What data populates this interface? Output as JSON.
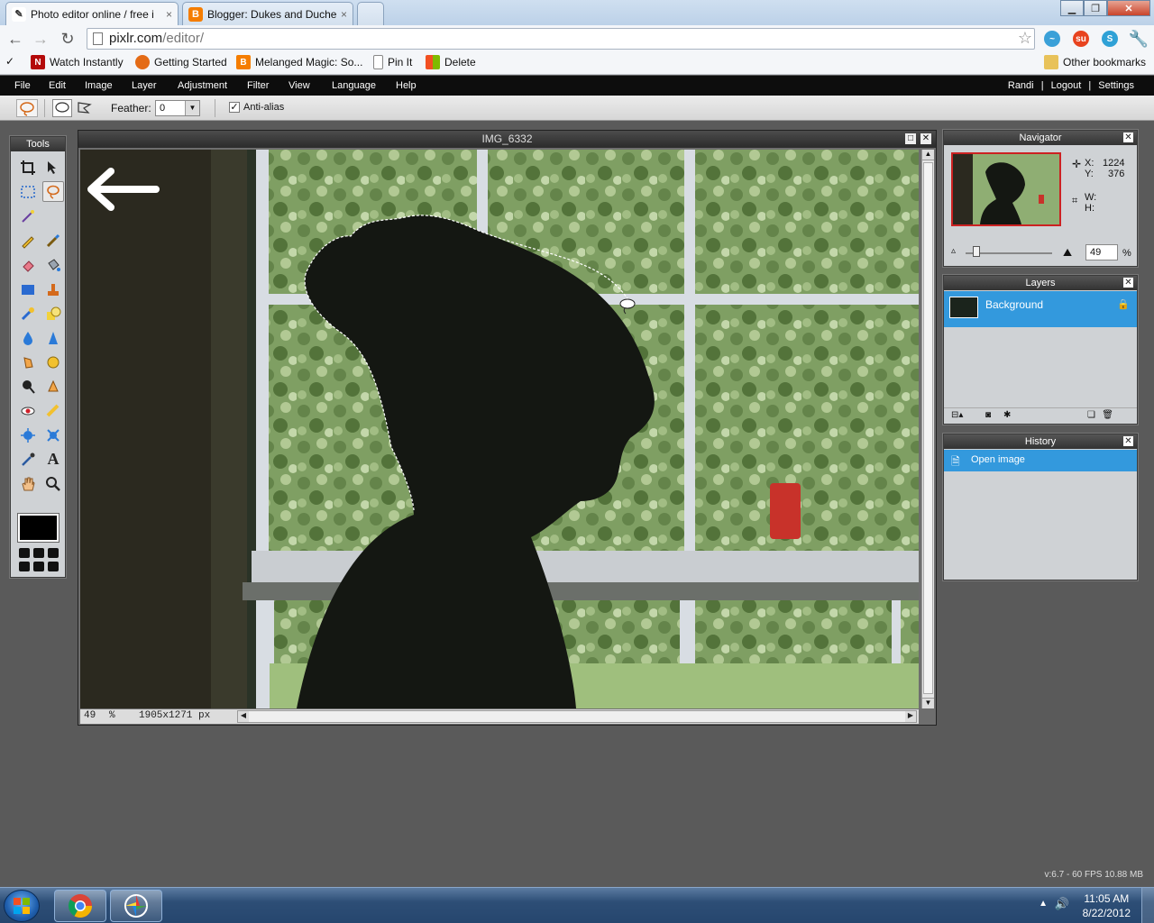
{
  "browser": {
    "tabs": [
      {
        "label": "Photo editor online / free i",
        "close": "×",
        "active": true
      },
      {
        "label": "Blogger: Dukes and Duche",
        "close": "×",
        "active": false
      }
    ],
    "url_host": "pixlr.com",
    "url_path": "/editor/",
    "bookmarks": [
      "Watch Instantly",
      "Getting Started",
      "Melanged Magic: So...",
      "Pin It",
      "Delete"
    ],
    "other_bookmarks": "Other bookmarks"
  },
  "app": {
    "menus": [
      "File",
      "Edit",
      "Image",
      "Layer",
      "Adjustment",
      "Filter",
      "View",
      "Language",
      "Help"
    ],
    "user": {
      "name": "Randi",
      "sep": "|",
      "logout": "Logout",
      "settings": "Settings"
    },
    "options": {
      "feather_label": "Feather:",
      "feather_value": "0",
      "antialias_label": "Anti-alias",
      "antialias_checked": true
    },
    "tools_title": "Tools",
    "document": {
      "title": "IMG_6332",
      "zoom": "49",
      "zoom_unit": "%",
      "dimensions": "1905x1271 px"
    },
    "navigator": {
      "title": "Navigator",
      "x_label": "X:",
      "x_value": "1224",
      "y_label": "Y:",
      "y_value": "376",
      "w_label": "W:",
      "h_label": "H:",
      "zoom": "49",
      "zoom_unit": "%"
    },
    "layers": {
      "title": "Layers",
      "items": [
        "Background"
      ]
    },
    "history": {
      "title": "History",
      "items": [
        "Open image"
      ]
    },
    "fps": "v:6.7 - 60 FPS 10.88 MB"
  },
  "taskbar": {
    "time": "11:05 AM",
    "date": "8/22/2012"
  },
  "colors": {
    "accent_blue": "#3399dd",
    "menubar": "#0d0d0d",
    "workspace": "#5a5a5a",
    "foreground_color": "#000000"
  }
}
